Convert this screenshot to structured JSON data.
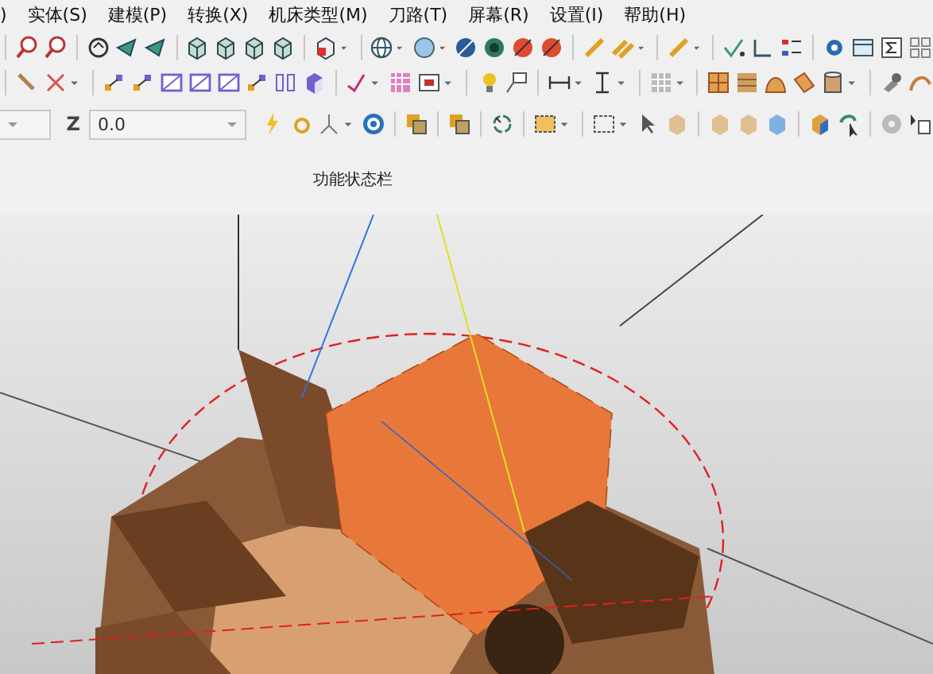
{
  "menu": [
    {
      "label": ")"
    },
    {
      "label": "实体(S)"
    },
    {
      "label": "建模(P)"
    },
    {
      "label": "转换(X)"
    },
    {
      "label": "机床类型(M)"
    },
    {
      "label": "刀路(T)"
    },
    {
      "label": "屏幕(R)"
    },
    {
      "label": "设置(I)"
    },
    {
      "label": "帮助(H)"
    }
  ],
  "coordinate_bar": {
    "z_label": "Z",
    "z_value": "0.0"
  },
  "status_label": "功能状态栏"
}
